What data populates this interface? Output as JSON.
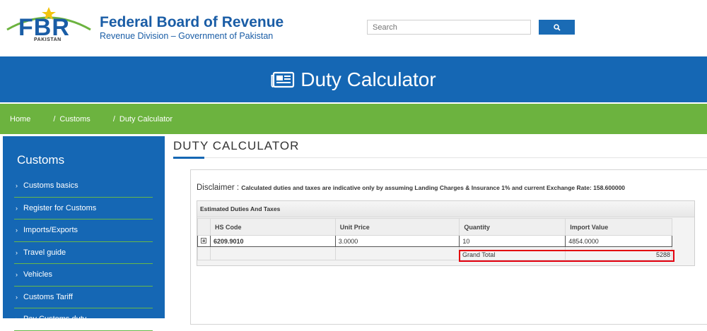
{
  "header": {
    "logo_text": "FBR",
    "logo_sub": "PAKISTAN",
    "org_name": "Federal Board of Revenue",
    "org_sub": "Revenue Division – Government of Pakistan",
    "search_placeholder": "Search",
    "search_icon": "search-icon"
  },
  "banner": {
    "icon": "newspaper-icon",
    "title": "Duty Calculator"
  },
  "breadcrumb": {
    "items": [
      "Home",
      "Customs",
      "Duty Calculator"
    ],
    "separator": "/"
  },
  "sidebar": {
    "title": "Customs",
    "items": [
      {
        "label": "Customs basics"
      },
      {
        "label": "Register for Customs"
      },
      {
        "label": "Imports/Exports"
      },
      {
        "label": "Travel guide"
      },
      {
        "label": "Vehicles"
      },
      {
        "label": "Customs Tariff"
      },
      {
        "label": "Pay Customs duty"
      }
    ]
  },
  "main": {
    "title": "DUTY CALCULATOR",
    "disclaimer_label": "Disclaimer :",
    "disclaimer_text": "Calculated duties and taxes are indicative only by assuming Landing Charges & Insurance 1% and current Exchange Rate: 158.600000",
    "grid": {
      "caption": "Estimated Duties And Taxes",
      "columns": [
        "HS Code",
        "Unit Price",
        "Quantity",
        "Import Value"
      ],
      "row": {
        "hs_code": "6209.9010",
        "unit_price": "3.0000",
        "quantity": "10",
        "import_value": "4854.0000"
      },
      "grand_total_label": "Grand Total",
      "grand_total_value": "5288"
    }
  },
  "colors": {
    "brand_blue": "#1567b4",
    "brand_green": "#6cb33f",
    "highlight_red": "#e3000f"
  }
}
